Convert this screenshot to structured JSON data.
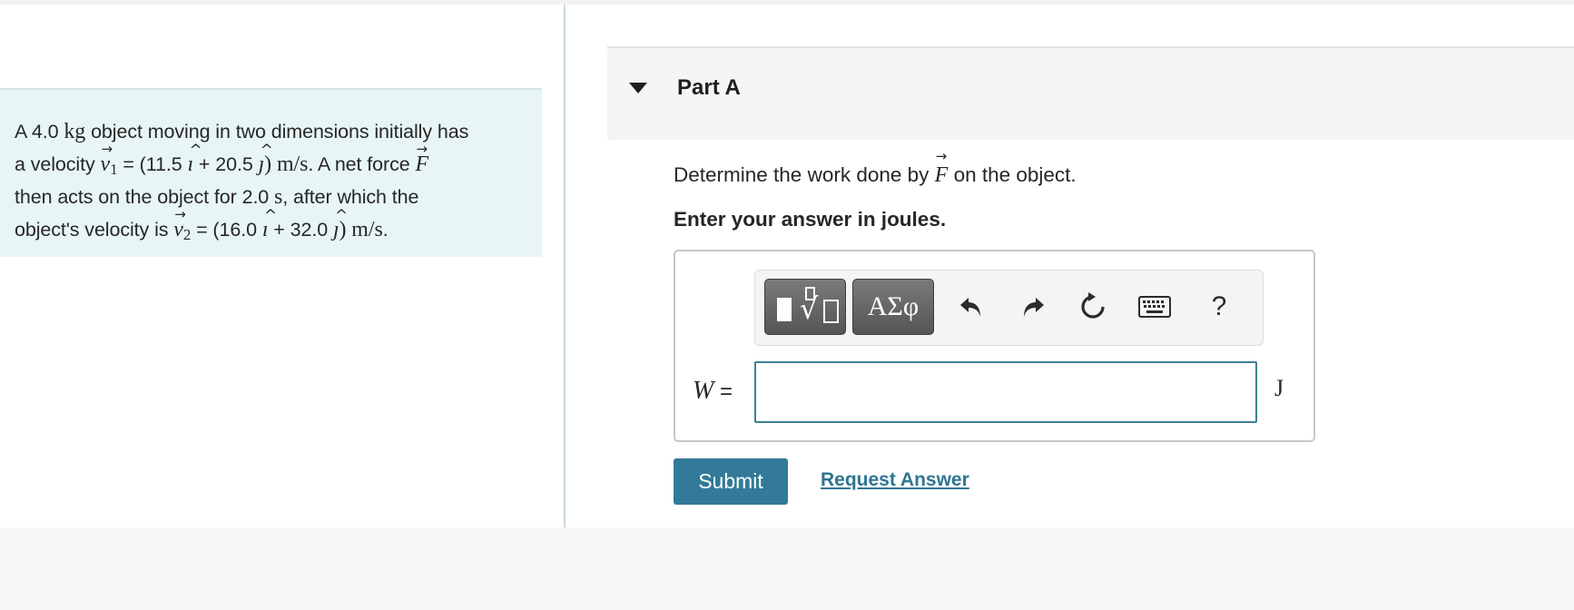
{
  "problem": {
    "lines": [
      [
        {
          "t": "A 4.0 "
        },
        {
          "m": "kg"
        },
        {
          "t": " object moving in two dimensions initially has"
        }
      ],
      [
        {
          "t": "a velocity "
        },
        {
          "vec": "v"
        },
        {
          "sub": "1"
        },
        {
          "t": " = (11.5 "
        },
        {
          "hat": "ı"
        },
        {
          "t": " + 20.5 "
        },
        {
          "hat": "ȷ"
        },
        {
          "m": ") m/s"
        },
        {
          "t": ". A net force "
        },
        {
          "vec": "F"
        }
      ],
      [
        {
          "t": "then acts on the object for 2.0 "
        },
        {
          "m": "s"
        },
        {
          "t": ", after which the"
        }
      ],
      [
        {
          "t": "object's velocity is "
        },
        {
          "vec": "v"
        },
        {
          "sub": "2"
        },
        {
          "t": " = (16.0 "
        },
        {
          "hat": "ı"
        },
        {
          "t": " + 32.0 "
        },
        {
          "hat": "ȷ"
        },
        {
          "m": ") m/s"
        },
        {
          "t": "."
        }
      ]
    ]
  },
  "part": {
    "title": "Part A",
    "question_before": "Determine the work done by ",
    "question_var": "F",
    "question_after": " on the object.",
    "instruction": "Enter your answer in joules."
  },
  "toolbar": {
    "greek_label": "ΑΣφ",
    "help_label": "?",
    "icons": [
      "templates-icon",
      "greek-letters-icon",
      "undo-icon",
      "redo-icon",
      "reset-icon",
      "keyboard-icon",
      "help-icon"
    ]
  },
  "answer": {
    "variable": "W",
    "equals": " =",
    "value": "",
    "unit": "J"
  },
  "actions": {
    "submit_label": "Submit",
    "request_label": "Request Answer"
  },
  "colors": {
    "problem_bg": "#e8f5f7",
    "submit_bg": "#337a98",
    "link": "#2f7591",
    "input_border": "#3d7f96"
  }
}
